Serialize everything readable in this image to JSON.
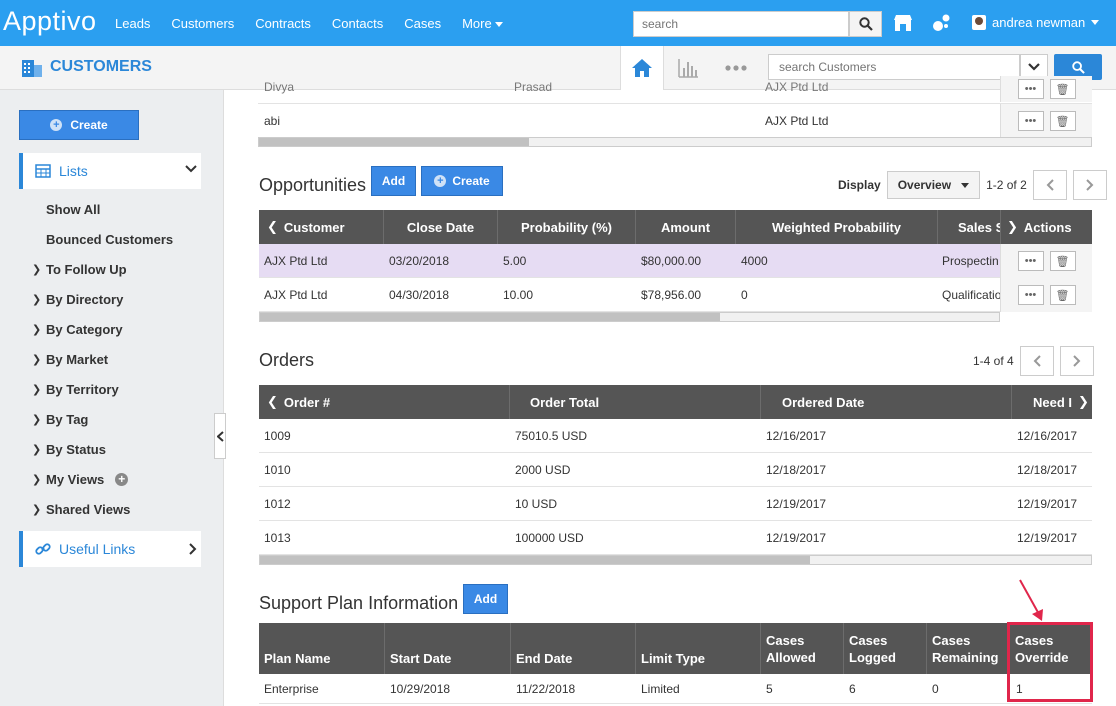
{
  "app": {
    "logo": "Apptivo",
    "nav": [
      "Leads",
      "Customers",
      "Contracts",
      "Contacts",
      "Cases",
      "More"
    ],
    "search_placeholder": "search",
    "user_name": "andrea newman"
  },
  "module": {
    "title": "CUSTOMERS",
    "search_placeholder": "search Customers"
  },
  "sidebar": {
    "create_label": "Create",
    "lists_label": "Lists",
    "items": [
      {
        "label": "Show All",
        "sub": true
      },
      {
        "label": "Bounced Customers",
        "sub": true
      },
      {
        "label": "To Follow Up"
      },
      {
        "label": "By Directory"
      },
      {
        "label": "By Category"
      },
      {
        "label": "By Market"
      },
      {
        "label": "By Territory"
      },
      {
        "label": "By Tag"
      },
      {
        "label": "By Status"
      },
      {
        "label": "My Views"
      },
      {
        "label": "Shared Views"
      }
    ],
    "useful_links_label": "Useful Links"
  },
  "contacts_partial": {
    "rows": [
      {
        "c1": "Divya",
        "c2": "Prasad",
        "c3": "AJX Ptd Ltd"
      },
      {
        "c1": "abi",
        "c2": "",
        "c3": "AJX Ptd Ltd"
      }
    ]
  },
  "opportunities": {
    "title": "Opportunities",
    "add_label": "Add",
    "create_label": "Create",
    "display_label": "Display",
    "display_value": "Overview",
    "pager": "1-2 of 2",
    "columns": [
      "Customer",
      "Close Date",
      "Probability (%)",
      "Amount",
      "Weighted Probability",
      "Sales S",
      "Actions"
    ],
    "rows": [
      {
        "customer": "AJX Ptd Ltd",
        "close_date": "03/20/2018",
        "probability": "5.00",
        "amount": "$80,000.00",
        "weighted": "4000",
        "stage": "Prospectin"
      },
      {
        "customer": "AJX Ptd Ltd",
        "close_date": "04/30/2018",
        "probability": "10.00",
        "amount": "$78,956.00",
        "weighted": "0",
        "stage": "Qualificatio"
      }
    ]
  },
  "orders": {
    "title": "Orders",
    "pager": "1-4 of 4",
    "columns": [
      "Order #",
      "Order Total",
      "Ordered Date",
      "Need I"
    ],
    "rows": [
      {
        "num": "1009",
        "total": "75010.5 USD",
        "ordered": "12/16/2017",
        "need": "12/16/2017"
      },
      {
        "num": "1010",
        "total": "2000 USD",
        "ordered": "12/18/2017",
        "need": "12/18/2017"
      },
      {
        "num": "1012",
        "total": "10 USD",
        "ordered": "12/19/2017",
        "need": "12/19/2017"
      },
      {
        "num": "1013",
        "total": "100000 USD",
        "ordered": "12/19/2017",
        "need": "12/19/2017"
      }
    ]
  },
  "support_plan": {
    "title": "Support Plan Information",
    "add_label": "Add",
    "columns": [
      [
        "Plan Name"
      ],
      [
        "Start Date"
      ],
      [
        "End Date"
      ],
      [
        "Limit Type"
      ],
      [
        "Cases",
        "Allowed"
      ],
      [
        "Cases",
        "Logged"
      ],
      [
        "Cases",
        "Remaining"
      ],
      [
        "Cases",
        "Override"
      ]
    ],
    "rows": [
      {
        "plan": "Enterprise",
        "start": "10/29/2018",
        "end": "11/22/2018",
        "limit": "Limited",
        "allowed": "5",
        "logged": "6",
        "remaining": "0",
        "override": "1"
      }
    ]
  },
  "colors": {
    "brand": "#2b9ff0",
    "accent": "#2b87d8",
    "highlight_row": "#e6dcf3",
    "annotation": "#e0264b"
  }
}
